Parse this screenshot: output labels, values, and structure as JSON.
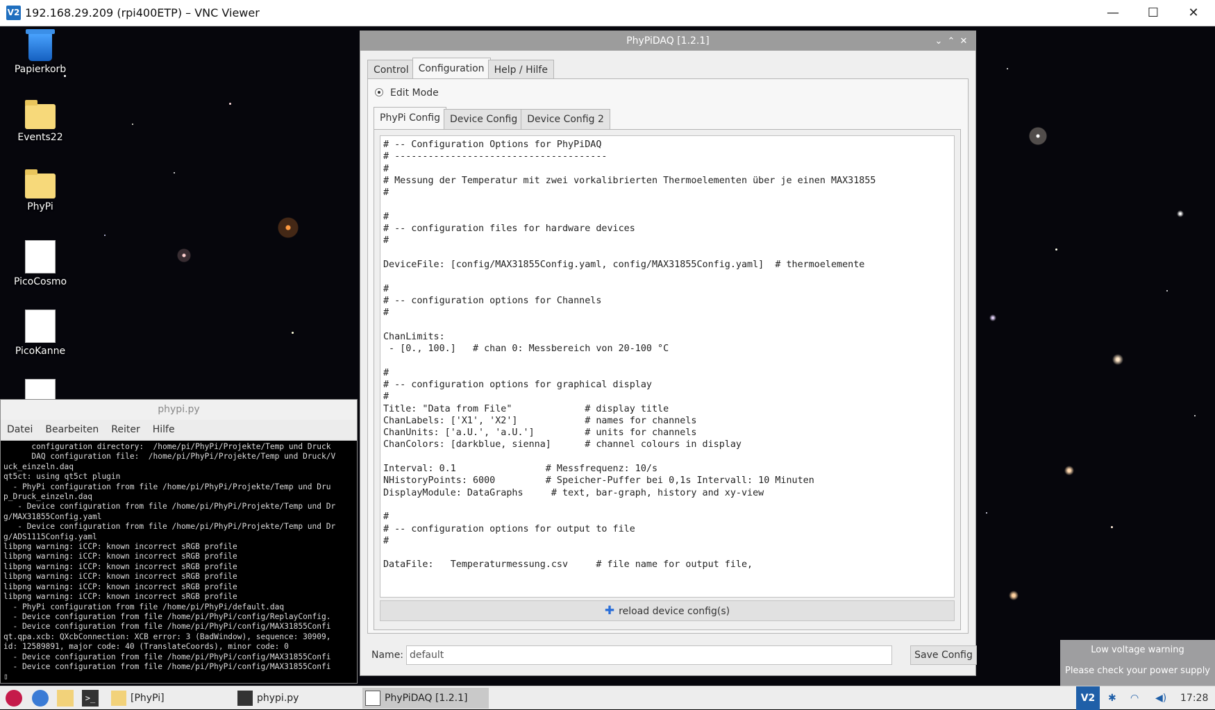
{
  "vnc": {
    "logo": "V2",
    "title": "192.168.29.209 (rpi400ETP) – VNC Viewer",
    "minimize": "—",
    "maximize": "☐",
    "close": "✕"
  },
  "desktop_icons": [
    {
      "label": "Papierkorb",
      "icon": "trash-icon"
    },
    {
      "label": "Events22",
      "icon": "folder-icon"
    },
    {
      "label": "PhyPi",
      "icon": "folder-icon"
    },
    {
      "label": "PicoCosmo",
      "icon": "app-icon"
    },
    {
      "label": "PicoKanne",
      "icon": "cup-icon"
    }
  ],
  "terminal": {
    "title": "phypi.py",
    "menu": [
      "Datei",
      "Bearbeiten",
      "Reiter",
      "Hilfe"
    ],
    "lines": [
      "      configuration directory:  /home/pi/PhyPi/Projekte/Temp und Druck",
      "      DAQ configuration file:  /home/pi/PhyPi/Projekte/Temp und Druck/V",
      "uck_einzeln.daq",
      "qt5ct: using qt5ct plugin",
      "  - PhyPi configuration from file /home/pi/PhyPi/Projekte/Temp und Dru",
      "p_Druck_einzeln.daq",
      "   - Device configuration from file /home/pi/PhyPi/Projekte/Temp und Dr",
      "g/MAX31855Config.yaml",
      "   - Device configuration from file /home/pi/PhyPi/Projekte/Temp und Dr",
      "g/ADS1115Config.yaml",
      "libpng warning: iCCP: known incorrect sRGB profile",
      "libpng warning: iCCP: known incorrect sRGB profile",
      "libpng warning: iCCP: known incorrect sRGB profile",
      "libpng warning: iCCP: known incorrect sRGB profile",
      "libpng warning: iCCP: known incorrect sRGB profile",
      "libpng warning: iCCP: known incorrect sRGB profile",
      "  - PhyPi configuration from file /home/pi/PhyPi/default.daq",
      "  - Device configuration from file /home/pi/PhyPi/config/ReplayConfig.",
      "  - Device configuration from file /home/pi/PhyPi/config/MAX31855Confi",
      "qt.qpa.xcb: QXcbConnection: XCB error: 3 (BadWindow), sequence: 30909,",
      "id: 12589891, major code: 40 (TranslateCoords), minor code: 0",
      "  - Device configuration from file /home/pi/PhyPi/config/MAX31855Confi",
      "  - Device configuration from file /home/pi/PhyPi/config/MAX31855Confi",
      "▯"
    ]
  },
  "app": {
    "title": "PhyPiDAQ [1.2.1]",
    "title_buttons": [
      "⌄",
      "⌃",
      "✕"
    ],
    "tabs": [
      "Control",
      "Configuration",
      "Help / Hilfe"
    ],
    "active_tab": 1,
    "edit_mode_label": "Edit Mode",
    "subtabs": [
      "PhyPi Config",
      "Device Config",
      "Device Config 2"
    ],
    "active_subtab": 0,
    "config_text": "# -- Configuration Options for PhyPiDAQ\n# --------------------------------------\n#\n# Messung der Temperatur mit zwei vorkalibrierten Thermoelementen über je einen MAX31855\n#\n\n#\n# -- configuration files for hardware devices\n#\n\nDeviceFile: [config/MAX31855Config.yaml, config/MAX31855Config.yaml]  # thermoelemente\n\n#\n# -- configuration options for Channels\n#\n\nChanLimits:\n - [0., 100.]   # chan 0: Messbereich von 20-100 °C\n\n#\n# -- configuration options for graphical display\n#\nTitle: \"Data from File\"             # display title\nChanLabels: ['X1', 'X2']            # names for channels\nChanUnits: ['a.U.', 'a.U.']         # units for channels\nChanColors: [darkblue, sienna]      # channel colours in display\n\nInterval: 0.1                # Messfrequenz: 10/s\nNHistoryPoints: 6000         # Speicher-Puffer bei 0,1s Intervall: 10 Minuten\nDisplayModule: DataGraphs     # text, bar-graph, history and xy-view\n\n#\n# -- configuration options for output to file\n#\n\nDataFile:   Temperaturmessung.csv     # file name for output file,",
    "reload_label": "reload device config(s)",
    "name_label": "Name:",
    "name_value": "default",
    "save_label": "Save Config"
  },
  "notification": {
    "title": "Low voltage warning",
    "message": "Please check your power supply"
  },
  "taskbar": {
    "tasks": [
      {
        "label": "[PhyPi]",
        "icon": "folder-icon"
      },
      {
        "label": "phypi.py",
        "icon": "terminal-icon"
      },
      {
        "label": "PhyPiDAQ [1.2.1]",
        "icon": "window-icon"
      }
    ],
    "vnc_tray_label": "V2",
    "clock": "17:28"
  }
}
